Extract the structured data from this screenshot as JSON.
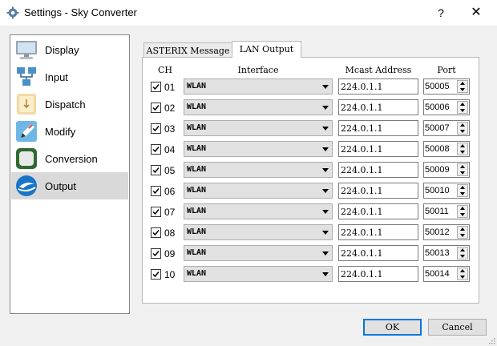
{
  "window": {
    "title": "Settings - Sky Converter",
    "help": "?",
    "close": "✕"
  },
  "sidebar": {
    "items": [
      {
        "label": "Display",
        "icon": "monitor-icon"
      },
      {
        "label": "Input",
        "icon": "network-icon"
      },
      {
        "label": "Dispatch",
        "icon": "dispatch-icon"
      },
      {
        "label": "Modify",
        "icon": "pencil-icon"
      },
      {
        "label": "Conversion",
        "icon": "conversion-icon"
      },
      {
        "label": "Output",
        "icon": "output-icon",
        "selected": true
      }
    ]
  },
  "tabs": [
    {
      "label": "ASTERIX Message",
      "active": false
    },
    {
      "label": "LAN Output",
      "active": true
    }
  ],
  "table": {
    "headers": {
      "ch": "CH",
      "interface": "Interface",
      "mcast": "Mcast Address",
      "port": "Port"
    },
    "rows": [
      {
        "checked": true,
        "ch": "01",
        "interface": "WLAN",
        "address": "224.0.1.1",
        "port": "50005"
      },
      {
        "checked": true,
        "ch": "02",
        "interface": "WLAN",
        "address": "224.0.1.1",
        "port": "50006"
      },
      {
        "checked": true,
        "ch": "03",
        "interface": "WLAN",
        "address": "224.0.1.1",
        "port": "50007"
      },
      {
        "checked": true,
        "ch": "04",
        "interface": "WLAN",
        "address": "224.0.1.1",
        "port": "50008"
      },
      {
        "checked": true,
        "ch": "05",
        "interface": "WLAN",
        "address": "224.0.1.1",
        "port": "50009"
      },
      {
        "checked": true,
        "ch": "06",
        "interface": "WLAN",
        "address": "224.0.1.1",
        "port": "50010"
      },
      {
        "checked": true,
        "ch": "07",
        "interface": "WLAN",
        "address": "224.0.1.1",
        "port": "50011"
      },
      {
        "checked": true,
        "ch": "08",
        "interface": "WLAN",
        "address": "224.0.1.1",
        "port": "50012"
      },
      {
        "checked": true,
        "ch": "09",
        "interface": "WLAN",
        "address": "224.0.1.1",
        "port": "50013"
      },
      {
        "checked": true,
        "ch": "10",
        "interface": "WLAN",
        "address": "224.0.1.1",
        "port": "50014"
      }
    ]
  },
  "buttons": {
    "ok": "OK",
    "cancel": "Cancel"
  },
  "colors": {
    "accent": "#0078d7",
    "selection": "#d9d9d9"
  }
}
